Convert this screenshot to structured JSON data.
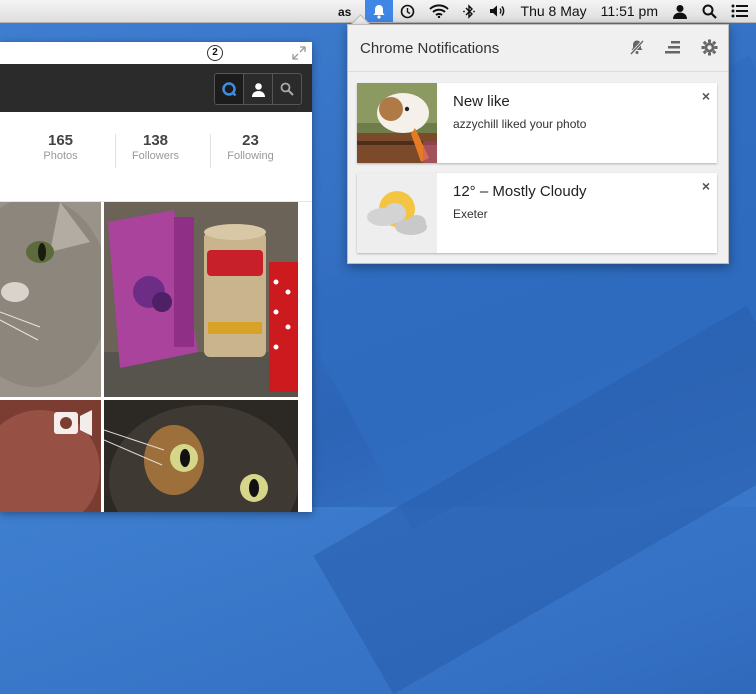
{
  "menubar": {
    "items": [
      "lastfm-icon",
      "notification-bell-icon",
      "timemachine-icon",
      "wifi-icon",
      "bluetooth-icon",
      "volume-icon"
    ],
    "date": "Thu 8 May",
    "time": "11:51 pm"
  },
  "profile": {
    "badge_count": "2",
    "stats": [
      {
        "count": "165",
        "label": "Photos"
      },
      {
        "count": "138",
        "label": "Followers"
      },
      {
        "count": "23",
        "label": "Following"
      }
    ]
  },
  "notifications": {
    "title": "Chrome Notifications",
    "cards": [
      {
        "title": "New like",
        "message": "azzychill liked your photo"
      },
      {
        "title": "12° – Mostly Cloudy",
        "message": "Exeter"
      }
    ],
    "close_symbol": "×"
  },
  "colors": {
    "desktop": "#3470c4",
    "menubar_active": "#3f86e6",
    "nav_dark": "#2b2b2b",
    "sun": "#f4c542"
  }
}
